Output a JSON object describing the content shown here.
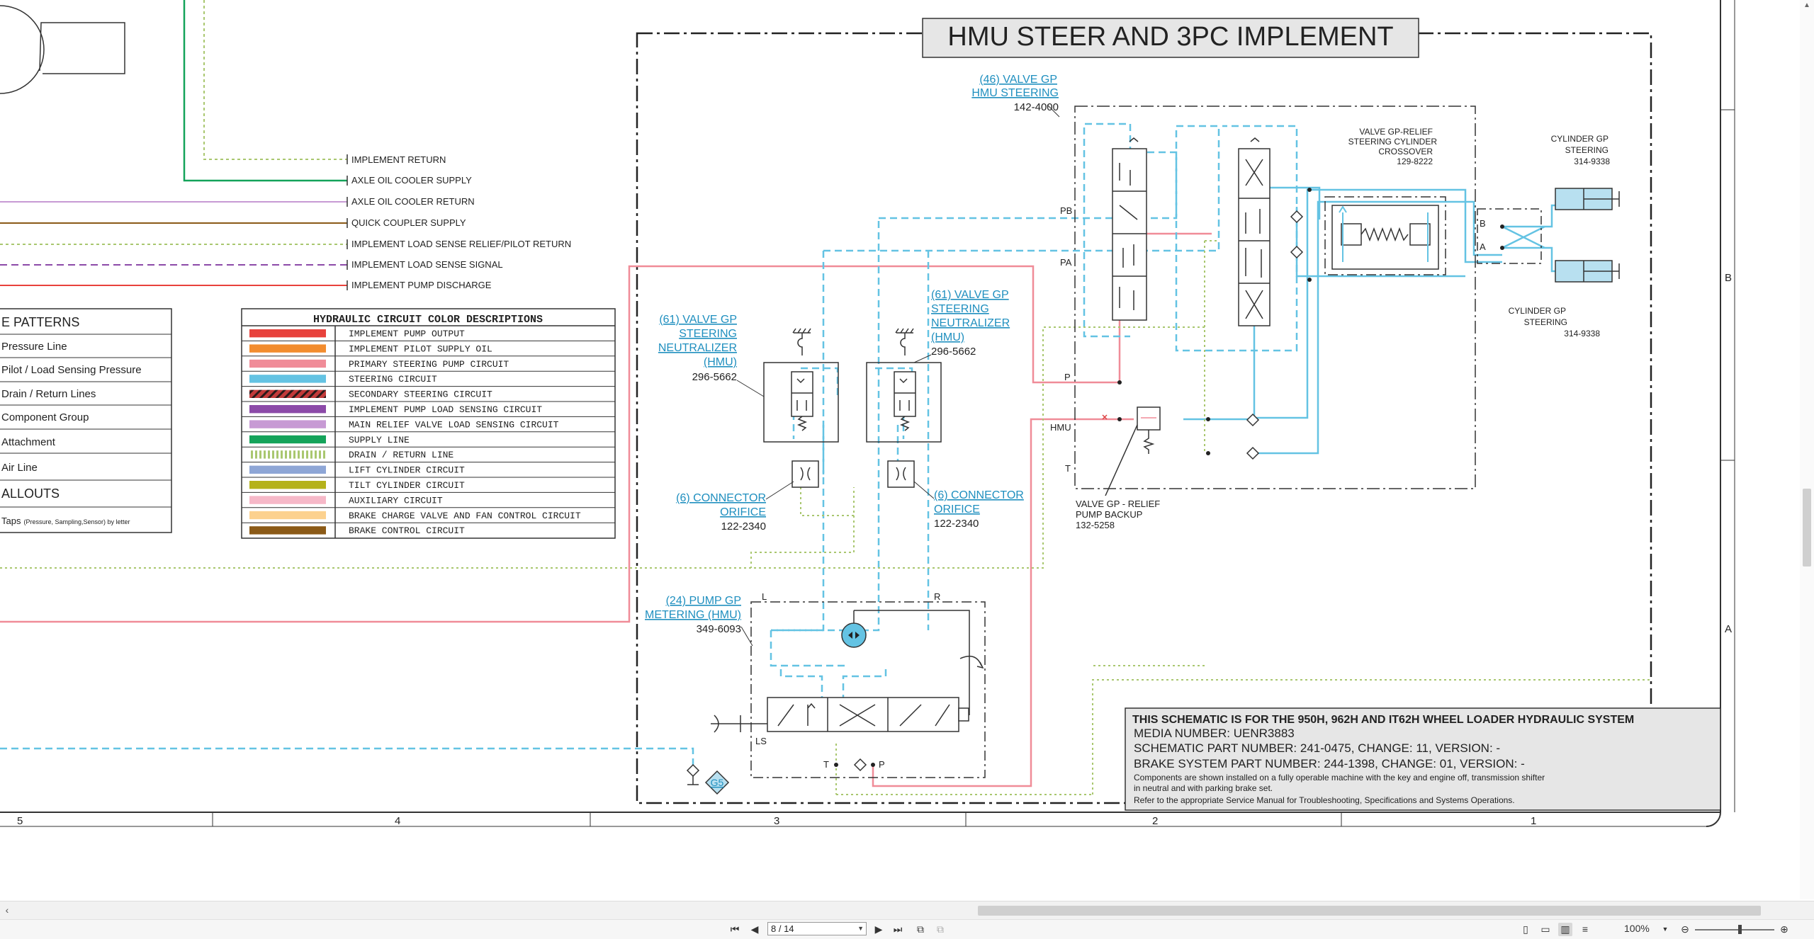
{
  "title": "HMU STEER AND 3PC IMPLEMENT",
  "line_legend": [
    "IMPLEMENT RETURN",
    "AXLE OIL COOLER SUPPLY",
    "AXLE OIL COOLER RETURN",
    "QUICK COUPLER SUPPLY",
    "IMPLEMENT LOAD SENSE RELIEF/PILOT RETURN",
    "IMPLEMENT LOAD SENSE SIGNAL",
    "IMPLEMENT PUMP DISCHARGE"
  ],
  "line_patterns": {
    "heading": "E PATTERNS",
    "items": [
      "Pressure Line",
      "Pilot / Load Sensing Pressure",
      "Drain / Return Lines",
      "Component Group",
      "Attachment",
      "Air Line"
    ],
    "callouts_heading": "ALLOUTS",
    "taps_label": "Taps",
    "taps_note": "(Pressure, Sampling,Sensor) by letter"
  },
  "color_table": {
    "heading": "HYDRAULIC CIRCUIT COLOR DESCRIPTIONS",
    "rows": [
      {
        "label": "IMPLEMENT PUMP OUTPUT",
        "color": "#e8423c"
      },
      {
        "label": "IMPLEMENT PILOT SUPPLY OIL",
        "color": "#f28c2e"
      },
      {
        "label": "PRIMARY STEERING PUMP CIRCUIT",
        "color": "#f08c98"
      },
      {
        "label": "STEERING CIRCUIT",
        "color": "#64c3e3"
      },
      {
        "label": "SECONDARY STEERING CIRCUIT",
        "color": "#c23a3a"
      },
      {
        "label": "IMPLEMENT PUMP LOAD SENSING CIRCUIT",
        "color": "#8c4aa8"
      },
      {
        "label": "MAIN RELIEF VALVE LOAD SENSING CIRCUIT",
        "color": "#c79ad4"
      },
      {
        "label": "SUPPLY LINE",
        "color": "#14a35a"
      },
      {
        "label": "DRAIN / RETURN LINE",
        "color": "#a9c76f"
      },
      {
        "label": "LIFT CYLINDER CIRCUIT",
        "color": "#8ea6d6"
      },
      {
        "label": "TILT CYLINDER CIRCUIT",
        "color": "#b5b21a"
      },
      {
        "label": "AUXILIARY CIRCUIT",
        "color": "#f6b8c8"
      },
      {
        "label": "BRAKE CHARGE VALVE AND FAN CONTROL CIRCUIT",
        "color": "#fcd18e"
      },
      {
        "label": "BRAKE CONTROL CIRCUIT",
        "color": "#8b5a17"
      }
    ]
  },
  "components": {
    "hmu_steering": {
      "link1": "(46) VALVE GP",
      "link2": "HMU STEERING",
      "part": "142-4000"
    },
    "relief_crossover": {
      "line1": "VALVE GP-RELIEF",
      "line2": "STEERING CYLINDER",
      "line3": "CROSSOVER",
      "part": "129-8222"
    },
    "cylinder_top": {
      "line1": "CYLINDER GP",
      "line2": "STEERING",
      "part": "314-9338"
    },
    "cylinder_bottom": {
      "line1": "CYLINDER GP",
      "line2": "STEERING",
      "part": "314-9338"
    },
    "neutralizer_left": {
      "l1": "(61) VALVE GP",
      "l2": "STEERING",
      "l3": "NEUTRALIZER",
      "l4": "(HMU)",
      "part": "296-5662"
    },
    "neutralizer_right": {
      "l1": "(61) VALVE GP",
      "l2": "STEERING",
      "l3": "NEUTRALIZER",
      "l4": "(HMU)",
      "part": "296-5662"
    },
    "orifice_left": {
      "l1": "(6) CONNECTOR",
      "l2": "ORIFICE",
      "part": "122-2340"
    },
    "orifice_right": {
      "l1": "(6) CONNECTOR",
      "l2": "ORIFICE",
      "part": "122-2340"
    },
    "pump_metering": {
      "l1": "(24) PUMP GP",
      "l2": "METERING (HMU)",
      "part": "349-6093"
    },
    "relief_backup": {
      "l1": "VALVE GP - RELIEF",
      "l2": "PUMP BACKUP",
      "part": "132-5258"
    }
  },
  "port_labels": {
    "pb": "PB",
    "pa": "PA",
    "p": "P",
    "hmu": "HMU",
    "t": "T",
    "b": "B",
    "a": "A",
    "l": "L",
    "r": "R",
    "ls": "LS",
    "pump_t": "T",
    "pump_p": "P",
    "tap": "G5"
  },
  "info_box": {
    "line1": "THIS SCHEMATIC IS FOR THE 950H, 962H AND IT62H WHEEL LOADER HYDRAULIC SYSTEM",
    "line2": "MEDIA NUMBER:  UENR3883",
    "line3": "SCHEMATIC PART NUMBER: 241-0475, CHANGE: 11, VERSION: -",
    "line4": "BRAKE SYSTEM PART NUMBER: 244-1398, CHANGE: 01, VERSION: -",
    "line5": "Components are shown installed on a fully operable machine with the key and engine off, transmission shifter",
    "line6": "in neutral and with parking brake set.",
    "line7": "Refer to the appropriate Service Manual for Troubleshooting, Specifications and Systems Operations."
  },
  "grid": {
    "columns": [
      "5",
      "4",
      "3",
      "2",
      "1"
    ],
    "rows": [
      "B",
      "A"
    ]
  },
  "viewer": {
    "page_value": "8 / 14",
    "zoom": "100%"
  }
}
